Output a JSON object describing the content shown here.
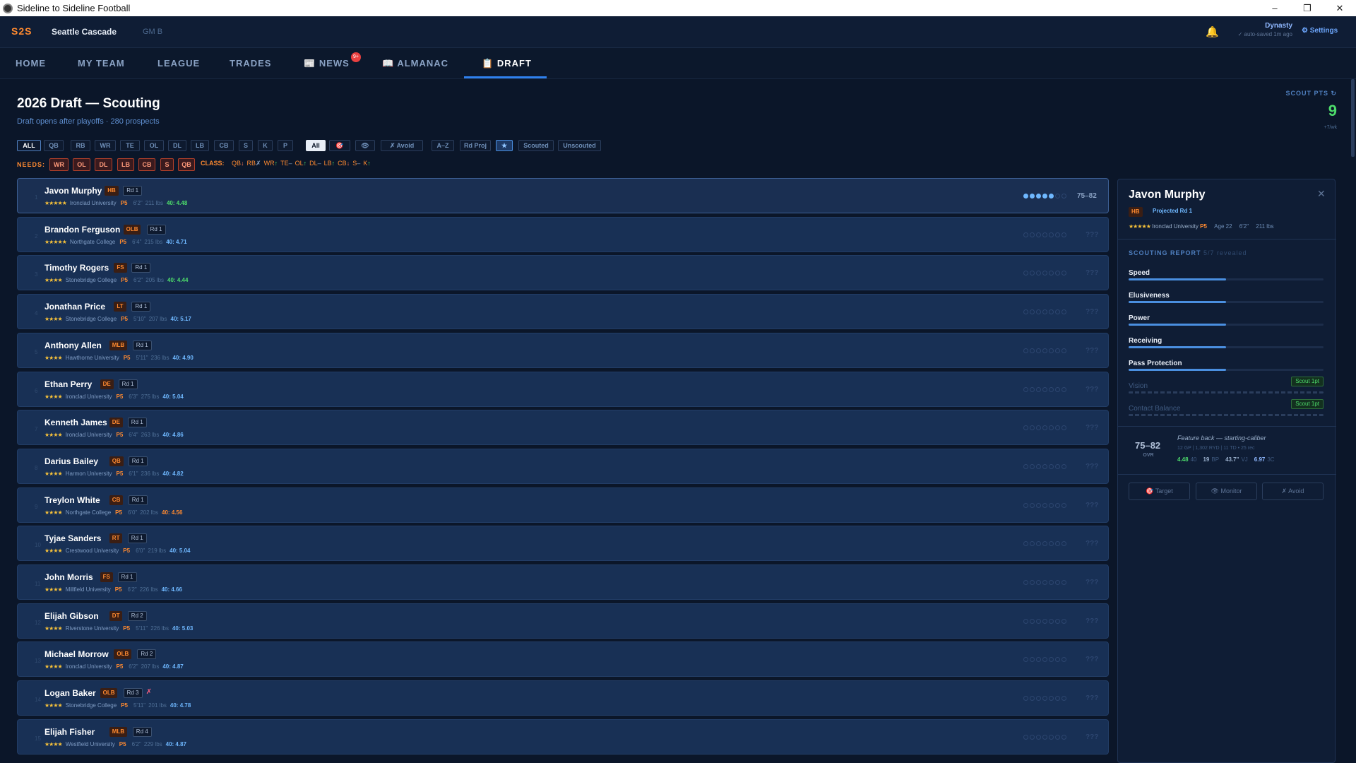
{
  "window": {
    "title": "Sideline to Sideline Football",
    "min": "–",
    "max": "❐",
    "close": "✕"
  },
  "topbar": {
    "brand": "S2S",
    "team": "Seattle Cascade",
    "gm": "GM B",
    "dynasty": "Dynasty",
    "autosave": "✓ auto-saved 1m ago",
    "settings": "⚙ Settings"
  },
  "nav": {
    "items": [
      "HOME",
      "MY TEAM",
      "LEAGUE",
      "TRADES",
      "NEWS",
      "ALMANAC",
      "DRAFT"
    ],
    "news_badge": "9+",
    "active": "DRAFT"
  },
  "page": {
    "title": "2026 Draft — Scouting",
    "subtitle": "Draft opens after playoffs · 280 prospects"
  },
  "scout": {
    "label": "SCOUT PTS ↻",
    "value": "9",
    "rate": "+7/wk"
  },
  "filters": {
    "positions": [
      "ALL",
      "QB",
      "RB",
      "WR",
      "TE",
      "OL",
      "DL",
      "LB",
      "CB",
      "S",
      "K",
      "P"
    ],
    "tags": [
      "All",
      "🎯",
      "👁",
      "✗ Avoid"
    ],
    "sorts": [
      "A–Z",
      "Rd Proj",
      "★",
      "Scouted",
      "Unscouted"
    ]
  },
  "needs": {
    "label": "NEEDS:",
    "items": [
      "WR",
      "OL",
      "DL",
      "LB",
      "CB",
      "S",
      "QB"
    ]
  },
  "class": {
    "label": "CLASS:",
    "items": [
      {
        "p": "QB",
        "t": "↓",
        "c": "dn"
      },
      {
        "p": "RB",
        "t": "✗",
        "c": "x"
      },
      {
        "p": "WR",
        "t": "↑",
        "c": "up"
      },
      {
        "p": "TE",
        "t": "–",
        "c": "x"
      },
      {
        "p": "OL",
        "t": "↑",
        "c": "up"
      },
      {
        "p": "DL",
        "t": "–",
        "c": "x"
      },
      {
        "p": "LB",
        "t": "↑",
        "c": "up"
      },
      {
        "p": "CB",
        "t": "↓",
        "c": "dn"
      },
      {
        "p": "S",
        "t": "–",
        "c": "x"
      },
      {
        "p": "K",
        "t": "↑",
        "c": "up"
      }
    ]
  },
  "prospects": [
    {
      "rank": "1",
      "name": "Javon Murphy",
      "pos": "HB",
      "rd": "Rd 1",
      "stars": "★★★★★",
      "school": "Ironclad University",
      "conf": "P5",
      "ht": "6'2\"",
      "wt": "211 lbs",
      "forty": "40: 4.48",
      "fc": "g",
      "dots": 5,
      "ovr": "75–82"
    },
    {
      "rank": "2",
      "name": "Brandon Ferguson",
      "pos": "OLB",
      "rd": "Rd 1",
      "stars": "★★★★★",
      "school": "Northgate College",
      "conf": "P5",
      "ht": "6'4\"",
      "wt": "215 lbs",
      "forty": "40: 4.71",
      "fc": "b",
      "dots": 0,
      "ovr": "???"
    },
    {
      "rank": "3",
      "name": "Timothy Rogers",
      "pos": "FS",
      "rd": "Rd 1",
      "stars": "★★★★",
      "school": "Stonebridge College",
      "conf": "P5",
      "ht": "6'2\"",
      "wt": "205 lbs",
      "forty": "40: 4.44",
      "fc": "g",
      "dots": 0,
      "ovr": "???"
    },
    {
      "rank": "4",
      "name": "Jonathan Price",
      "pos": "LT",
      "rd": "Rd 1",
      "stars": "★★★★",
      "school": "Stonebridge College",
      "conf": "P5",
      "ht": "5'10\"",
      "wt": "207 lbs",
      "forty": "40: 5.17",
      "fc": "b",
      "dots": 0,
      "ovr": "???"
    },
    {
      "rank": "5",
      "name": "Anthony Allen",
      "pos": "MLB",
      "rd": "Rd 1",
      "stars": "★★★★",
      "school": "Hawthorne University",
      "conf": "P5",
      "ht": "5'11\"",
      "wt": "236 lbs",
      "forty": "40: 4.90",
      "fc": "b",
      "dots": 0,
      "ovr": "???"
    },
    {
      "rank": "6",
      "name": "Ethan Perry",
      "pos": "DE",
      "rd": "Rd 1",
      "stars": "★★★★",
      "school": "Ironclad University",
      "conf": "P5",
      "ht": "6'3\"",
      "wt": "275 lbs",
      "forty": "40: 5.04",
      "fc": "b",
      "dots": 0,
      "ovr": "???"
    },
    {
      "rank": "7",
      "name": "Kenneth James",
      "pos": "DE",
      "rd": "Rd 1",
      "stars": "★★★★",
      "school": "Ironclad University",
      "conf": "P5",
      "ht": "6'4\"",
      "wt": "263 lbs",
      "forty": "40: 4.86",
      "fc": "b",
      "dots": 0,
      "ovr": "???"
    },
    {
      "rank": "8",
      "name": "Darius Bailey",
      "pos": "QB",
      "rd": "Rd 1",
      "stars": "★★★★",
      "school": "Harmon University",
      "conf": "P5",
      "ht": "6'1\"",
      "wt": "236 lbs",
      "forty": "40: 4.82",
      "fc": "b",
      "dots": 0,
      "ovr": "???"
    },
    {
      "rank": "9",
      "name": "Treylon White",
      "pos": "CB",
      "rd": "Rd 1",
      "stars": "★★★★",
      "school": "Northgate College",
      "conf": "P5",
      "ht": "6'0\"",
      "wt": "202 lbs",
      "forty": "40: 4.56",
      "fc": "o",
      "dots": 0,
      "ovr": "???"
    },
    {
      "rank": "10",
      "name": "Tyjae Sanders",
      "pos": "RT",
      "rd": "Rd 1",
      "stars": "★★★★",
      "school": "Crestwood University",
      "conf": "P5",
      "ht": "6'0\"",
      "wt": "219 lbs",
      "forty": "40: 5.04",
      "fc": "b",
      "dots": 0,
      "ovr": "???"
    },
    {
      "rank": "11",
      "name": "John Morris",
      "pos": "FS",
      "rd": "Rd 1",
      "stars": "★★★★",
      "school": "Millfield University",
      "conf": "P5",
      "ht": "6'2\"",
      "wt": "226 lbs",
      "forty": "40: 4.66",
      "fc": "b",
      "dots": 0,
      "ovr": "???"
    },
    {
      "rank": "12",
      "name": "Elijah Gibson",
      "pos": "DT",
      "rd": "Rd 2",
      "stars": "★★★★",
      "school": "Riverstone University",
      "conf": "P5",
      "ht": "5'11\"",
      "wt": "226 lbs",
      "forty": "40: 5.03",
      "fc": "b",
      "dots": 0,
      "ovr": "???"
    },
    {
      "rank": "13",
      "name": "Michael Morrow",
      "pos": "OLB",
      "rd": "Rd 2",
      "stars": "★★★★",
      "school": "Ironclad University",
      "conf": "P5",
      "ht": "6'2\"",
      "wt": "207 lbs",
      "forty": "40: 4.87",
      "fc": "b",
      "dots": 0,
      "ovr": "???"
    },
    {
      "rank": "14",
      "name": "Logan Baker",
      "pos": "OLB",
      "rd": "Rd 3",
      "stars": "★★★★",
      "school": "Stonebridge College",
      "conf": "P5",
      "ht": "5'11\"",
      "wt": "201 lbs",
      "forty": "40: 4.78",
      "fc": "b",
      "dots": 0,
      "ovr": "???",
      "flag": "✗"
    },
    {
      "rank": "15",
      "name": "Elijah Fisher",
      "pos": "MLB",
      "rd": "Rd 4",
      "stars": "★★★★",
      "school": "Westfield University",
      "conf": "P5",
      "ht": "6'2\"",
      "wt": "229 lbs",
      "forty": "40: 4.87",
      "fc": "b",
      "dots": 0,
      "ovr": "???"
    }
  ],
  "panel": {
    "name": "Javon Murphy",
    "close": "✕",
    "pos": "HB",
    "proj": "Projected Rd 1",
    "stars": "★★★★★",
    "school": "Ironclad University",
    "conf": "P5",
    "age": "Age 22",
    "ht": "6'2\"",
    "wt": "211 lbs",
    "report_label": "SCOUTING REPORT",
    "report_revealed": "5/7 revealed",
    "attributes": [
      {
        "name": "Speed",
        "fill": 0.5
      },
      {
        "name": "Elusiveness",
        "fill": 0.5
      },
      {
        "name": "Power",
        "fill": 0.5
      },
      {
        "name": "Receiving",
        "fill": 0.5
      },
      {
        "name": "Pass Protection",
        "fill": 0.5
      },
      {
        "name": "Vision",
        "locked": true,
        "btn": "Scout 1pt"
      },
      {
        "name": "Contact Balance",
        "locked": true,
        "btn": "Scout 1pt"
      }
    ],
    "ovr": "75–82",
    "ovr_label": "OVR",
    "fb_title": "Feature back — starting-caliber",
    "fb_stats": "12 GP | 1,302 RYD | 11 TD • 25 rec",
    "meas": [
      {
        "v": "4.48",
        "l": "40",
        "c": "g"
      },
      {
        "v": "19",
        "l": "BP",
        "c": "w"
      },
      {
        "v": "43.7\"",
        "l": "VJ",
        "c": "w"
      },
      {
        "v": "6.97",
        "l": "3C",
        "c": "b"
      }
    ],
    "actions": [
      "🎯 Target",
      "👁 Monitor",
      "✗ Avoid"
    ]
  }
}
